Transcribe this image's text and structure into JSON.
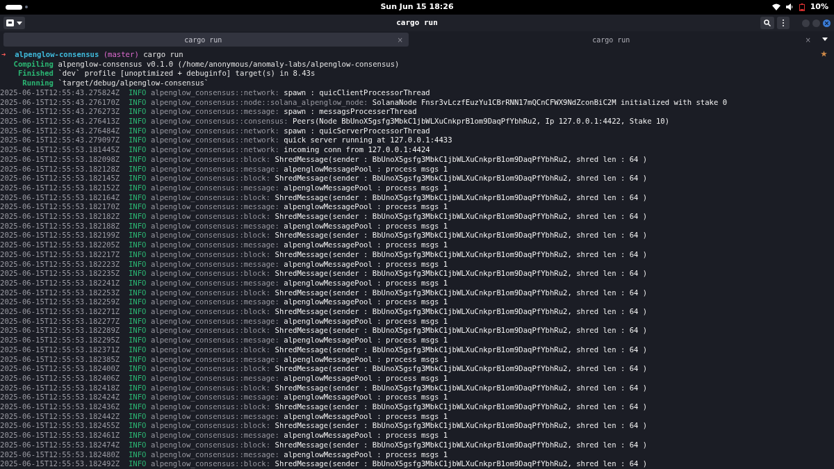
{
  "top_bar": {
    "clock": "Sun Jun 15 18:26",
    "battery": "10%"
  },
  "window": {
    "title": "cargo run"
  },
  "tabs": [
    {
      "label": "cargo run",
      "close": "×",
      "selected": true
    },
    {
      "label": "cargo run",
      "close": "×",
      "selected": false
    }
  ],
  "prompt": {
    "arrow": "➜",
    "directory": "alpenglow-consensus",
    "branch": "(master)",
    "command": "cargo run"
  },
  "build_lines": [
    {
      "status": "Compiling",
      "text": "alpenglow-consensus v0.1.0 (/home/anonymous/anomaly-labs/alpenglow-consensus)"
    },
    {
      "status": "Finished",
      "text": "`dev` profile [unoptimized + debuginfo] target(s) in 8.43s"
    },
    {
      "status": "Running",
      "text": "`target/debug/alpenglow-consensus`"
    }
  ],
  "log_lines": [
    {
      "timestamp": "2025-06-15T12:55:43.275824Z",
      "level": "INFO",
      "target": "alpenglow_consensus::network:",
      "message": "spawn : quicClientProcessorThread"
    },
    {
      "timestamp": "2025-06-15T12:55:43.276170Z",
      "level": "INFO",
      "target": "alpenglow_consensus::node::solana_alpenglow_node:",
      "message": "SolanaNode Fnsr3vLczfEuzYu1CBrRNN17mQCnCFWX9NdZconBiC2M initialized with stake 0"
    },
    {
      "timestamp": "2025-06-15T12:55:43.276273Z",
      "level": "INFO",
      "target": "alpenglow_consensus::message:",
      "message": "spawn : messagsProcesserThread"
    },
    {
      "timestamp": "2025-06-15T12:55:43.276413Z",
      "level": "INFO",
      "target": "alpenglow_consensus::consensus:",
      "message": "Peers(Node BbUnoX5gsfg3MbkC1jbWLXuCnkprB1om9DaqPfYbhRu2, Ip 127.0.0.1:4422, Stake 10)"
    },
    {
      "timestamp": "2025-06-15T12:55:43.276484Z",
      "level": "INFO",
      "target": "alpenglow_consensus::network:",
      "message": "spawn : quicServerProcessorThread"
    },
    {
      "timestamp": "2025-06-15T12:55:43.279097Z",
      "level": "INFO",
      "target": "alpenglow_consensus::network:",
      "message": "quick server running at 127.0.0.1:4433"
    },
    {
      "timestamp": "2025-06-15T12:55:53.181445Z",
      "level": "INFO",
      "target": "alpenglow_consensus::network:",
      "message": "incoming conn from 127.0.0.1:4424"
    },
    {
      "timestamp": "2025-06-15T12:55:53.182098Z",
      "level": "INFO",
      "target": "alpenglow_consensus::block:",
      "message": "ShredMessage(sender : BbUnoX5gsfg3MbkC1jbWLXuCnkprB1om9DaqPfYbhRu2, shred len : 64 )"
    },
    {
      "timestamp": "2025-06-15T12:55:53.182128Z",
      "level": "INFO",
      "target": "alpenglow_consensus::message:",
      "message": "alpenglowMessagePool : process msgs 1"
    },
    {
      "timestamp": "2025-06-15T12:55:53.182145Z",
      "level": "INFO",
      "target": "alpenglow_consensus::block:",
      "message": "ShredMessage(sender : BbUnoX5gsfg3MbkC1jbWLXuCnkprB1om9DaqPfYbhRu2, shred len : 64 )"
    },
    {
      "timestamp": "2025-06-15T12:55:53.182152Z",
      "level": "INFO",
      "target": "alpenglow_consensus::message:",
      "message": "alpenglowMessagePool : process msgs 1"
    },
    {
      "timestamp": "2025-06-15T12:55:53.182164Z",
      "level": "INFO",
      "target": "alpenglow_consensus::block:",
      "message": "ShredMessage(sender : BbUnoX5gsfg3MbkC1jbWLXuCnkprB1om9DaqPfYbhRu2, shred len : 64 )"
    },
    {
      "timestamp": "2025-06-15T12:55:53.182170Z",
      "level": "INFO",
      "target": "alpenglow_consensus::message:",
      "message": "alpenglowMessagePool : process msgs 1"
    },
    {
      "timestamp": "2025-06-15T12:55:53.182182Z",
      "level": "INFO",
      "target": "alpenglow_consensus::block:",
      "message": "ShredMessage(sender : BbUnoX5gsfg3MbkC1jbWLXuCnkprB1om9DaqPfYbhRu2, shred len : 64 )"
    },
    {
      "timestamp": "2025-06-15T12:55:53.182188Z",
      "level": "INFO",
      "target": "alpenglow_consensus::message:",
      "message": "alpenglowMessagePool : process msgs 1"
    },
    {
      "timestamp": "2025-06-15T12:55:53.182199Z",
      "level": "INFO",
      "target": "alpenglow_consensus::block:",
      "message": "ShredMessage(sender : BbUnoX5gsfg3MbkC1jbWLXuCnkprB1om9DaqPfYbhRu2, shred len : 64 )"
    },
    {
      "timestamp": "2025-06-15T12:55:53.182205Z",
      "level": "INFO",
      "target": "alpenglow_consensus::message:",
      "message": "alpenglowMessagePool : process msgs 1"
    },
    {
      "timestamp": "2025-06-15T12:55:53.182217Z",
      "level": "INFO",
      "target": "alpenglow_consensus::block:",
      "message": "ShredMessage(sender : BbUnoX5gsfg3MbkC1jbWLXuCnkprB1om9DaqPfYbhRu2, shred len : 64 )"
    },
    {
      "timestamp": "2025-06-15T12:55:53.182223Z",
      "level": "INFO",
      "target": "alpenglow_consensus::message:",
      "message": "alpenglowMessagePool : process msgs 1"
    },
    {
      "timestamp": "2025-06-15T12:55:53.182235Z",
      "level": "INFO",
      "target": "alpenglow_consensus::block:",
      "message": "ShredMessage(sender : BbUnoX5gsfg3MbkC1jbWLXuCnkprB1om9DaqPfYbhRu2, shred len : 64 )"
    },
    {
      "timestamp": "2025-06-15T12:55:53.182241Z",
      "level": "INFO",
      "target": "alpenglow_consensus::message:",
      "message": "alpenglowMessagePool : process msgs 1"
    },
    {
      "timestamp": "2025-06-15T12:55:53.182253Z",
      "level": "INFO",
      "target": "alpenglow_consensus::block:",
      "message": "ShredMessage(sender : BbUnoX5gsfg3MbkC1jbWLXuCnkprB1om9DaqPfYbhRu2, shred len : 64 )"
    },
    {
      "timestamp": "2025-06-15T12:55:53.182259Z",
      "level": "INFO",
      "target": "alpenglow_consensus::message:",
      "message": "alpenglowMessagePool : process msgs 1"
    },
    {
      "timestamp": "2025-06-15T12:55:53.182271Z",
      "level": "INFO",
      "target": "alpenglow_consensus::block:",
      "message": "ShredMessage(sender : BbUnoX5gsfg3MbkC1jbWLXuCnkprB1om9DaqPfYbhRu2, shred len : 64 )"
    },
    {
      "timestamp": "2025-06-15T12:55:53.182277Z",
      "level": "INFO",
      "target": "alpenglow_consensus::message:",
      "message": "alpenglowMessagePool : process msgs 1"
    },
    {
      "timestamp": "2025-06-15T12:55:53.182289Z",
      "level": "INFO",
      "target": "alpenglow_consensus::block:",
      "message": "ShredMessage(sender : BbUnoX5gsfg3MbkC1jbWLXuCnkprB1om9DaqPfYbhRu2, shred len : 64 )"
    },
    {
      "timestamp": "2025-06-15T12:55:53.182295Z",
      "level": "INFO",
      "target": "alpenglow_consensus::message:",
      "message": "alpenglowMessagePool : process msgs 1"
    },
    {
      "timestamp": "2025-06-15T12:55:53.182371Z",
      "level": "INFO",
      "target": "alpenglow_consensus::block:",
      "message": "ShredMessage(sender : BbUnoX5gsfg3MbkC1jbWLXuCnkprB1om9DaqPfYbhRu2, shred len : 64 )"
    },
    {
      "timestamp": "2025-06-15T12:55:53.182385Z",
      "level": "INFO",
      "target": "alpenglow_consensus::message:",
      "message": "alpenglowMessagePool : process msgs 1"
    },
    {
      "timestamp": "2025-06-15T12:55:53.182400Z",
      "level": "INFO",
      "target": "alpenglow_consensus::block:",
      "message": "ShredMessage(sender : BbUnoX5gsfg3MbkC1jbWLXuCnkprB1om9DaqPfYbhRu2, shred len : 64 )"
    },
    {
      "timestamp": "2025-06-15T12:55:53.182406Z",
      "level": "INFO",
      "target": "alpenglow_consensus::message:",
      "message": "alpenglowMessagePool : process msgs 1"
    },
    {
      "timestamp": "2025-06-15T12:55:53.182418Z",
      "level": "INFO",
      "target": "alpenglow_consensus::block:",
      "message": "ShredMessage(sender : BbUnoX5gsfg3MbkC1jbWLXuCnkprB1om9DaqPfYbhRu2, shred len : 64 )"
    },
    {
      "timestamp": "2025-06-15T12:55:53.182424Z",
      "level": "INFO",
      "target": "alpenglow_consensus::message:",
      "message": "alpenglowMessagePool : process msgs 1"
    },
    {
      "timestamp": "2025-06-15T12:55:53.182436Z",
      "level": "INFO",
      "target": "alpenglow_consensus::block:",
      "message": "ShredMessage(sender : BbUnoX5gsfg3MbkC1jbWLXuCnkprB1om9DaqPfYbhRu2, shred len : 64 )"
    },
    {
      "timestamp": "2025-06-15T12:55:53.182442Z",
      "level": "INFO",
      "target": "alpenglow_consensus::message:",
      "message": "alpenglowMessagePool : process msgs 1"
    },
    {
      "timestamp": "2025-06-15T12:55:53.182455Z",
      "level": "INFO",
      "target": "alpenglow_consensus::block:",
      "message": "ShredMessage(sender : BbUnoX5gsfg3MbkC1jbWLXuCnkprB1om9DaqPfYbhRu2, shred len : 64 )"
    },
    {
      "timestamp": "2025-06-15T12:55:53.182461Z",
      "level": "INFO",
      "target": "alpenglow_consensus::message:",
      "message": "alpenglowMessagePool : process msgs 1"
    },
    {
      "timestamp": "2025-06-15T12:55:53.182474Z",
      "level": "INFO",
      "target": "alpenglow_consensus::block:",
      "message": "ShredMessage(sender : BbUnoX5gsfg3MbkC1jbWLXuCnkprB1om9DaqPfYbhRu2, shred len : 64 )"
    },
    {
      "timestamp": "2025-06-15T12:55:53.182480Z",
      "level": "INFO",
      "target": "alpenglow_consensus::message:",
      "message": "alpenglowMessagePool : process msgs 1"
    },
    {
      "timestamp": "2025-06-15T12:55:53.182492Z",
      "level": "INFO",
      "target": "alpenglow_consensus::block:",
      "message": "ShredMessage(sender : BbUnoX5gsfg3MbkC1jbWLXuCnkprB1om9DaqPfYbhRu2, shred len : 64 )"
    }
  ]
}
